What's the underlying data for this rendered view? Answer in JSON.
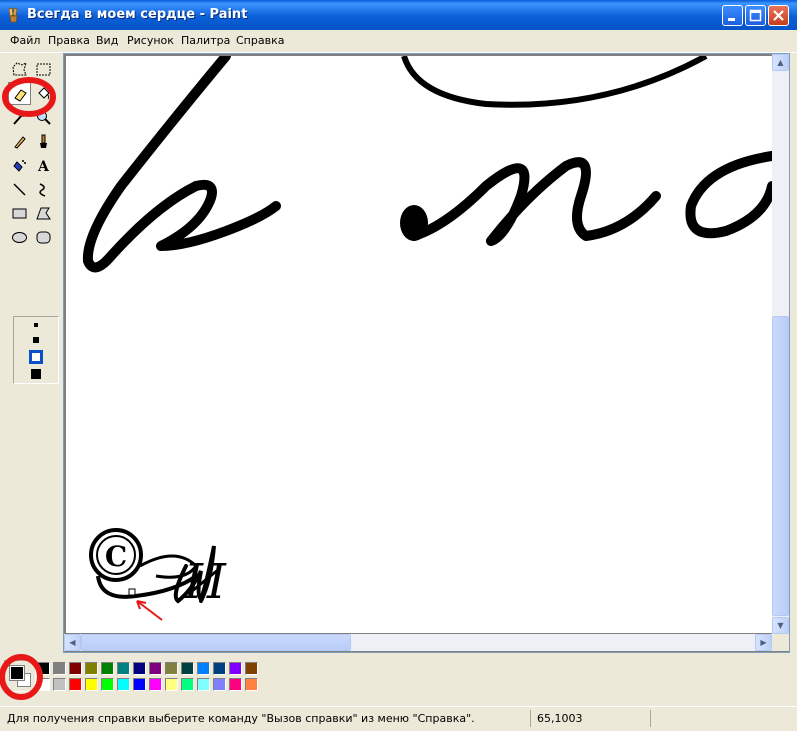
{
  "window": {
    "title": "Всегда в моем сердце - Paint"
  },
  "menu": {
    "file": "Файл",
    "edit": "Правка",
    "view": "Вид",
    "image": "Рисунок",
    "palette": "Палитра",
    "help": "Справка"
  },
  "canvas": {
    "handwriting_text": "в мо"
  },
  "signature": {
    "copyright_symbol": "C",
    "initial": "И"
  },
  "tools": [
    "free-form-select",
    "rect-select",
    "eraser",
    "fill",
    "color-picker",
    "magnifier",
    "pencil",
    "brush",
    "airbrush",
    "text",
    "line",
    "curve",
    "rectangle",
    "polygon",
    "ellipse",
    "rounded-rectangle"
  ],
  "palette": {
    "colors_row1": [
      "#000000",
      "#808080",
      "#800000",
      "#808000",
      "#008000",
      "#008080",
      "#000080",
      "#800080",
      "#808040",
      "#004040",
      "#0080ff",
      "#004080",
      "#8000ff",
      "#804000"
    ],
    "colors_row2": [
      "#ffffff",
      "#c0c0c0",
      "#ff0000",
      "#ffff00",
      "#00ff00",
      "#00ffff",
      "#0000ff",
      "#ff00ff",
      "#ffff80",
      "#00ff80",
      "#80ffff",
      "#8080ff",
      "#ff0080",
      "#ff8040"
    ],
    "foreground": "#000000",
    "background": "#ffffff"
  },
  "status": {
    "help_text": "Для получения справки выберите команду \"Вызов справки\" из меню \"Справка\".",
    "coords": "65,1003"
  }
}
